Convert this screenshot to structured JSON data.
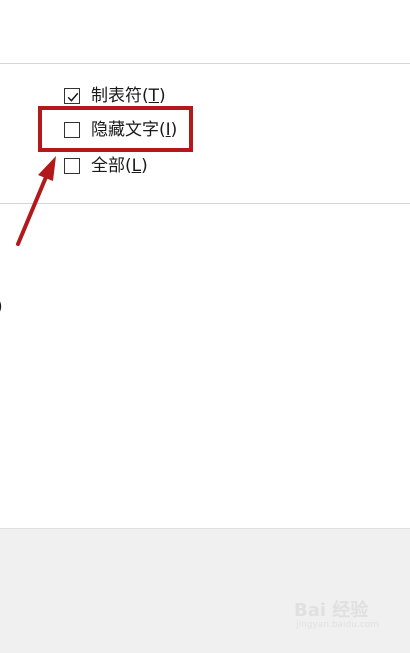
{
  "options": [
    {
      "label": "制表符(",
      "accel": "T",
      "suffix": ")",
      "checked": true
    },
    {
      "label": "隐藏文字(",
      "accel": "I",
      "suffix": ")",
      "checked": false
    },
    {
      "label": "全部(",
      "accel": "L",
      "suffix": ")",
      "checked": false
    }
  ],
  "left_edge_text": ")",
  "annotation": {
    "highlight_color": "#b3191a",
    "arrow_color": "#b3191a"
  },
  "watermark": {
    "brand": "Bai 经验",
    "sub": "jingyan.baidu.com"
  }
}
